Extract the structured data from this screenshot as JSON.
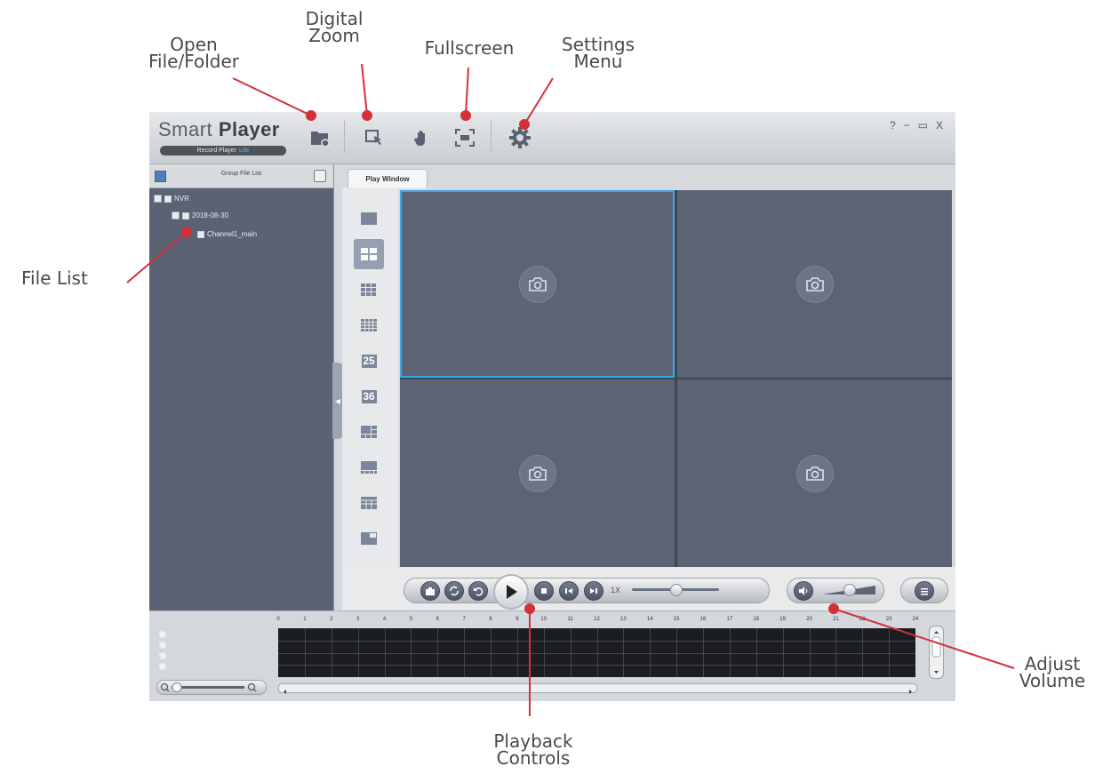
{
  "annotations": {
    "open_file": "Open\nFile/Folder",
    "digital_zoom": "Digital\nZoom",
    "fullscreen": "Fullscreen",
    "settings": "Settings\nMenu",
    "file_list": "File List",
    "adjust_volume": "Adjust\nVolume",
    "playback_controls": "Playback\nControls"
  },
  "app": {
    "brand": {
      "name_light": "Smart",
      "name_bold": "Player",
      "sub": "Record Player",
      "sub_accent": "Lite"
    },
    "window_controls": {
      "help": "?",
      "minimize": "−",
      "maximize": "▭",
      "close": "X"
    },
    "file_panel": {
      "title": "Group File List",
      "tree": {
        "root": "NVR",
        "date": "2018-08-30",
        "channel": "Channel1_main"
      }
    },
    "tab_label": "Play Window",
    "split_numbers": {
      "s25": "25",
      "s36": "36"
    },
    "speed_label": "1X",
    "playback": {
      "speed_position": 0.5,
      "volume_level": 0.5
    },
    "timeline": {
      "hours": [
        "0",
        "1",
        "2",
        "3",
        "4",
        "5",
        "6",
        "7",
        "8",
        "9",
        "10",
        "11",
        "12",
        "13",
        "14",
        "15",
        "16",
        "17",
        "18",
        "19",
        "20",
        "21",
        "22",
        "23",
        "24"
      ]
    }
  },
  "colors": {
    "accent": "#3aa7e6",
    "callout": "#d3313a",
    "panel": "#5a6274",
    "video_cell": "#5b6374"
  }
}
